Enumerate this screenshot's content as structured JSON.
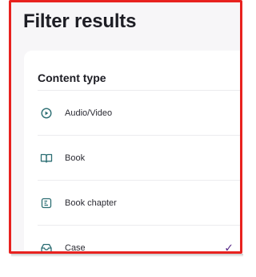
{
  "page": {
    "title": "Filter results"
  },
  "content_type": {
    "heading": "Content type",
    "options": [
      {
        "label": "Audio/Video",
        "icon": "play-circle-icon",
        "selected": false
      },
      {
        "label": "Book",
        "icon": "open-book-icon",
        "selected": false
      },
      {
        "label": "Book chapter",
        "icon": "book-chapter-icon",
        "selected": false
      },
      {
        "label": "Case",
        "icon": "case-tray-icon",
        "selected": true
      }
    ],
    "check_mark": "✓"
  },
  "colors": {
    "icon": "#2c6e73",
    "check": "#5a2d8a",
    "frame_border": "#e8221f"
  }
}
